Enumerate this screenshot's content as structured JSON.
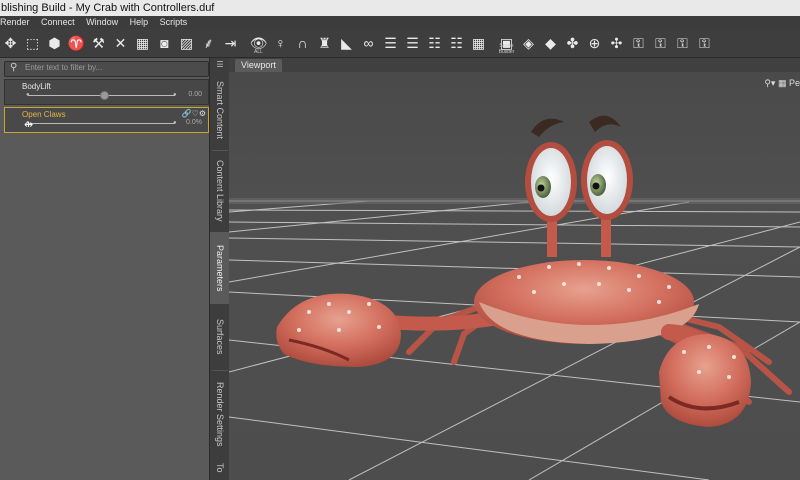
{
  "window": {
    "title": "blishing Build - My Crab with Controllers.duf"
  },
  "menu": [
    "Render",
    "Connect",
    "Window",
    "Help",
    "Scripts"
  ],
  "toolbar": {
    "icons": [
      "move-icon",
      "scale-icon",
      "bend-icon",
      "morph-icon",
      "joint-icon",
      "geometry-editor-icon",
      "node-weight-icon",
      "camera-icon",
      "render-icon",
      "layout-icon",
      "import-icon",
      "eye-icon",
      "pose-figure-icon",
      "hair-icon",
      "shirt-icon",
      "surface-icon",
      "glasses-icon",
      "list-icon",
      "list2-icon",
      "list3-icon",
      "list4-icon",
      "grid-icon",
      "scene-builder-icon",
      "transfer-icon",
      "bones-icon",
      "align-icon",
      "lock-icon",
      "lock2-icon",
      "lock3-icon",
      "lock4-icon",
      "lock5-icon",
      "lock6-icon"
    ],
    "sub_labels": {
      "eye": "ALL",
      "scene": "Scene Builder"
    }
  },
  "parameters": {
    "filter_placeholder": "Enter text to filter by...",
    "items": [
      {
        "name": "BodyLift",
        "value": "0.00",
        "fraction": 0.5
      },
      {
        "name": "Open Claws",
        "value": "0.0%",
        "fraction": 0.0
      }
    ]
  },
  "side_tabs": [
    "Smart Content",
    "Content Library",
    "Parameters",
    "Surfaces",
    "Render Settings",
    "To"
  ],
  "viewport": {
    "tab_label": "Viewport",
    "control_label": "Pe"
  },
  "colors": {
    "accent": "#c9a531",
    "crab": "#d46a5a",
    "grid": "#cfcfcf"
  }
}
